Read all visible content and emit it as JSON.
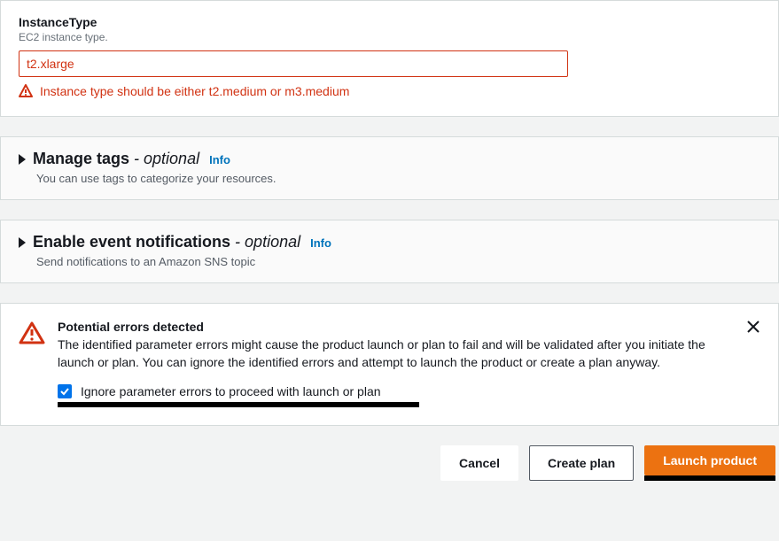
{
  "instance_type": {
    "label": "InstanceType",
    "description": "EC2 instance type.",
    "value": "t2.xlarge",
    "error": "Instance type should be either t2.medium or m3.medium"
  },
  "manage_tags": {
    "title": "Manage tags",
    "optional_suffix": " - optional",
    "info": "Info",
    "description": "You can use tags to categorize your resources."
  },
  "event_notifications": {
    "title": "Enable event notifications",
    "optional_suffix": " - optional",
    "info": "Info",
    "description": "Send notifications to an Amazon SNS topic"
  },
  "alert": {
    "title": "Potential errors detected",
    "message": "The identified parameter errors might cause the product launch or plan to fail and will be validated after you initiate the launch or plan. You can ignore the identified errors and attempt to launch the product or create a plan anyway.",
    "checkbox_label": "Ignore parameter errors to proceed with launch or plan"
  },
  "buttons": {
    "cancel": "Cancel",
    "create_plan": "Create plan",
    "launch_product": "Launch product"
  },
  "colors": {
    "error": "#d13212",
    "primary": "#ec7211",
    "link": "#0073bb",
    "checkbox": "#0073ea"
  }
}
